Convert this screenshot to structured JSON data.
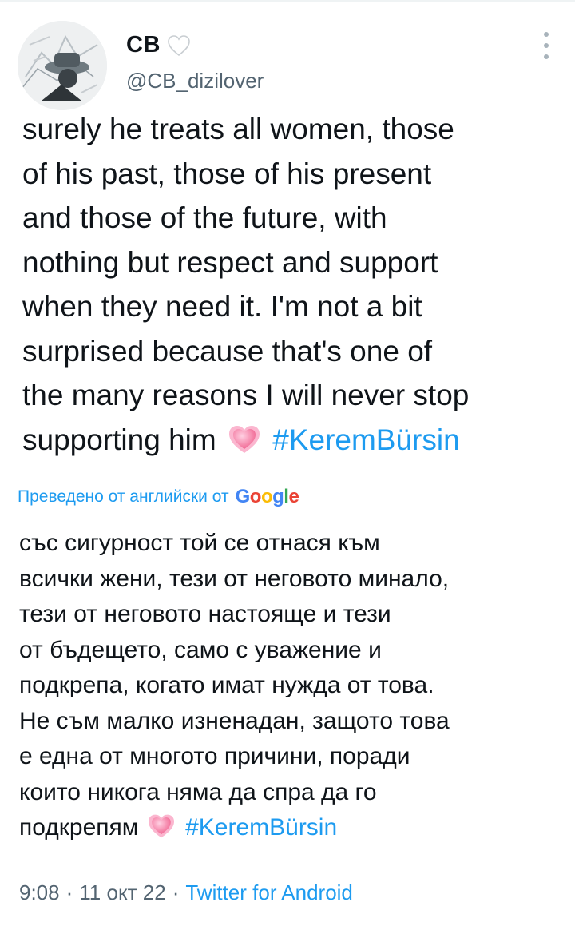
{
  "author": {
    "display_name": "CB",
    "handle": "@CB_dizilover",
    "avatar_icon": "avatar-photo",
    "name_badge_icon": "white-heart-icon"
  },
  "tweet": {
    "text": "surely he treats all women, those\nof his past, those of his present\nand those of the future, with\nnothing but respect and support\nwhen they need it. I'm not a bit\nsurprised because that's one of\nthe many reasons I will never stop\nsupporting him",
    "emoji_icon": "growing-heart-icon",
    "hashtag": "#KeremBürsin"
  },
  "translation": {
    "label": "Преведено от английски от",
    "provider_logo": "Google",
    "text": "със сигурност той се отнася към\nвсички жени, тези от неговото минало,\nтези от неговото настояще и тези\nот бъдещето, само с уважение и\nподкрепа, когато имат нужда от това.\nНе съм малко изненадан, защото това\nе една от многото причини, поради\nкоито никога няма да спра да го\nподкрепям",
    "emoji_icon": "growing-heart-icon",
    "hashtag": "#KeremBürsin"
  },
  "meta": {
    "time": "9:08",
    "separator": "·",
    "date": "11 окт 22",
    "source": "Twitter for Android"
  },
  "colors": {
    "link": "#1d9bf0",
    "secondary_text": "#536471",
    "primary_text": "#0f1419"
  }
}
